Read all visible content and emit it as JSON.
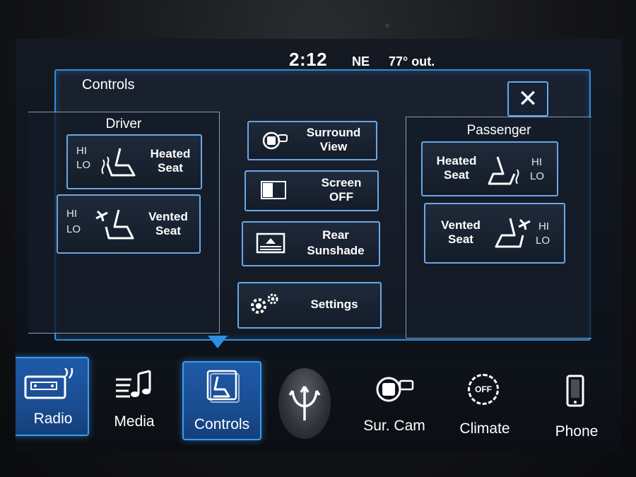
{
  "status": {
    "time": "2:12",
    "heading": "NE",
    "temperature": "77° out."
  },
  "panel": {
    "title": "Controls",
    "close_label": "✕"
  },
  "driver": {
    "title": "Driver",
    "heated": {
      "label_1": "Heated",
      "label_2": "Seat",
      "hi": "HI",
      "lo": "LO"
    },
    "vented": {
      "label_1": "Vented",
      "label_2": "Seat",
      "hi": "HI",
      "lo": "LO"
    }
  },
  "center": {
    "surround": {
      "label_1": "Surround",
      "label_2": "View"
    },
    "screen_off": {
      "label_1": "Screen",
      "label_2": "OFF"
    },
    "sunshade": {
      "label_1": "Rear",
      "label_2": "Sunshade"
    },
    "settings": {
      "label": "Settings"
    }
  },
  "passenger": {
    "title": "Passenger",
    "heated": {
      "label_1": "Heated",
      "label_2": "Seat",
      "hi": "HI",
      "lo": "LO"
    },
    "vented": {
      "label_1": "Vented",
      "label_2": "Seat",
      "hi": "HI",
      "lo": "LO"
    }
  },
  "nav": {
    "radio": "Radio",
    "media": "Media",
    "controls": "Controls",
    "surcam": "Sur. Cam",
    "climate": "Climate",
    "climate_badge": "OFF",
    "phone": "Phone",
    "active": "controls"
  },
  "colors": {
    "accent": "#2d8fe0",
    "active_nav": "#1f5aa8",
    "border": "#6aa7e6"
  }
}
